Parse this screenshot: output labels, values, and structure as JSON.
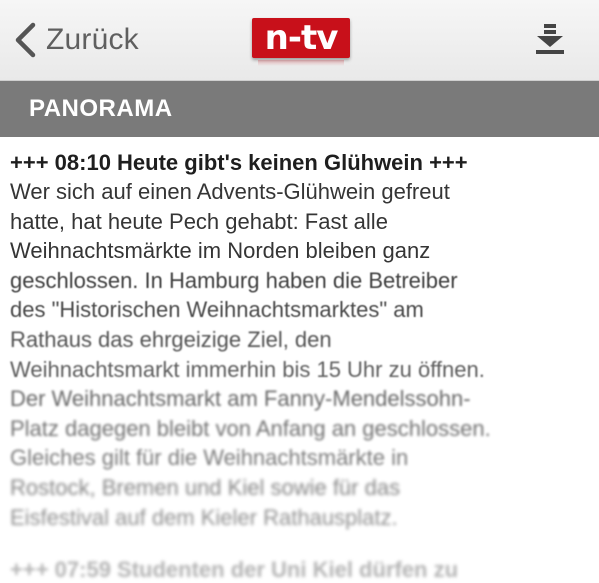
{
  "header": {
    "back_label": "Zurück",
    "logo_text": "n-tv"
  },
  "section": {
    "title": "PANORAMA"
  },
  "article": {
    "headline": "+++ 08:10 Heute gibt's keinen Glühwein +++",
    "body_lines": [
      "Wer sich auf einen Advents-Glühwein gefreut",
      "hatte, hat heute Pech gehabt: Fast alle",
      "Weihnachtsmärkte im Norden bleiben ganz",
      "geschlossen. In Hamburg haben die Betreiber",
      "des \"Historischen Weihnachtsmarktes\" am",
      "Rathaus das ehrgeizige Ziel, den",
      "Weihnachtsmarkt immerhin bis 15 Uhr zu öffnen.",
      "Der Weihnachtsmarkt am Fanny-Mendelssohn-",
      "Platz dagegen bleibt von Anfang an geschlossen.",
      "Gleiches gilt für die Weihnachtsmärkte in",
      "Rostock, Bremen und Kiel sowie für das",
      "Eisfestival auf dem Kieler Rathausplatz."
    ]
  },
  "next_article": {
    "headline": "+++ 07:59 Studenten der Uni Kiel dürfen zu"
  },
  "colors": {
    "brand_red": "#c8101a",
    "section_bar": "#7a7a7a",
    "toolbar_text": "#5f5f5f"
  },
  "icons": {
    "back": "chevron-left-icon",
    "download": "download-icon"
  }
}
